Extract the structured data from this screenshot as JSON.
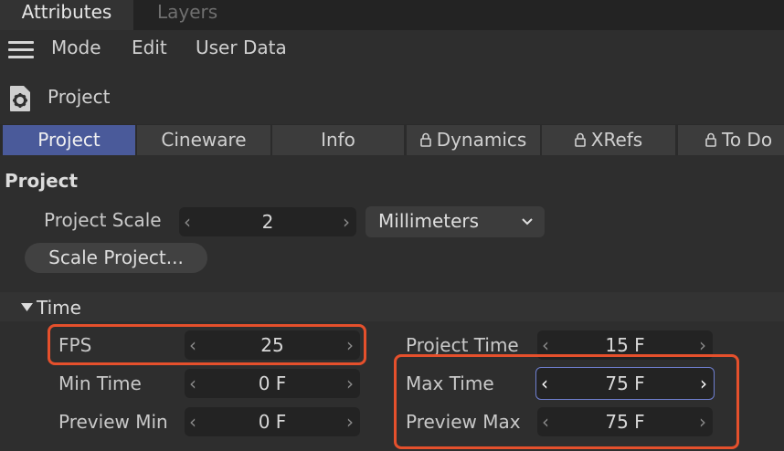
{
  "top_tabs": {
    "attributes": "Attributes",
    "layers": "Layers"
  },
  "menu": {
    "mode": "Mode",
    "edit": "Edit",
    "user_data": "User Data"
  },
  "object": {
    "title": "Project",
    "icon": "gear-document-icon"
  },
  "section_tabs": {
    "project": "Project",
    "cineware": "Cineware",
    "info": "Info",
    "dynamics": "Dynamics",
    "xrefs": "XRefs",
    "todo": "To Do"
  },
  "project_group": {
    "title": "Project",
    "scale_label": "Project Scale",
    "scale_value": "2",
    "unit_value": "Millimeters",
    "scale_button": "Scale Project..."
  },
  "time_group": {
    "title": "Time",
    "fps_label": "FPS",
    "fps_value": "25",
    "min_time_label": "Min Time",
    "min_time_value": "0 F",
    "preview_min_label": "Preview Min",
    "preview_min_value": "0 F",
    "project_time_label": "Project Time",
    "project_time_value": "15 F",
    "max_time_label": "Max Time",
    "max_time_value": "75 F",
    "preview_max_label": "Preview Max",
    "preview_max_value": "75 F"
  },
  "colors": {
    "active_tab": "#4a5a9a",
    "highlight": "#e5502c",
    "focus_border": "#6f7fd0",
    "background": "#2e2e2e"
  }
}
